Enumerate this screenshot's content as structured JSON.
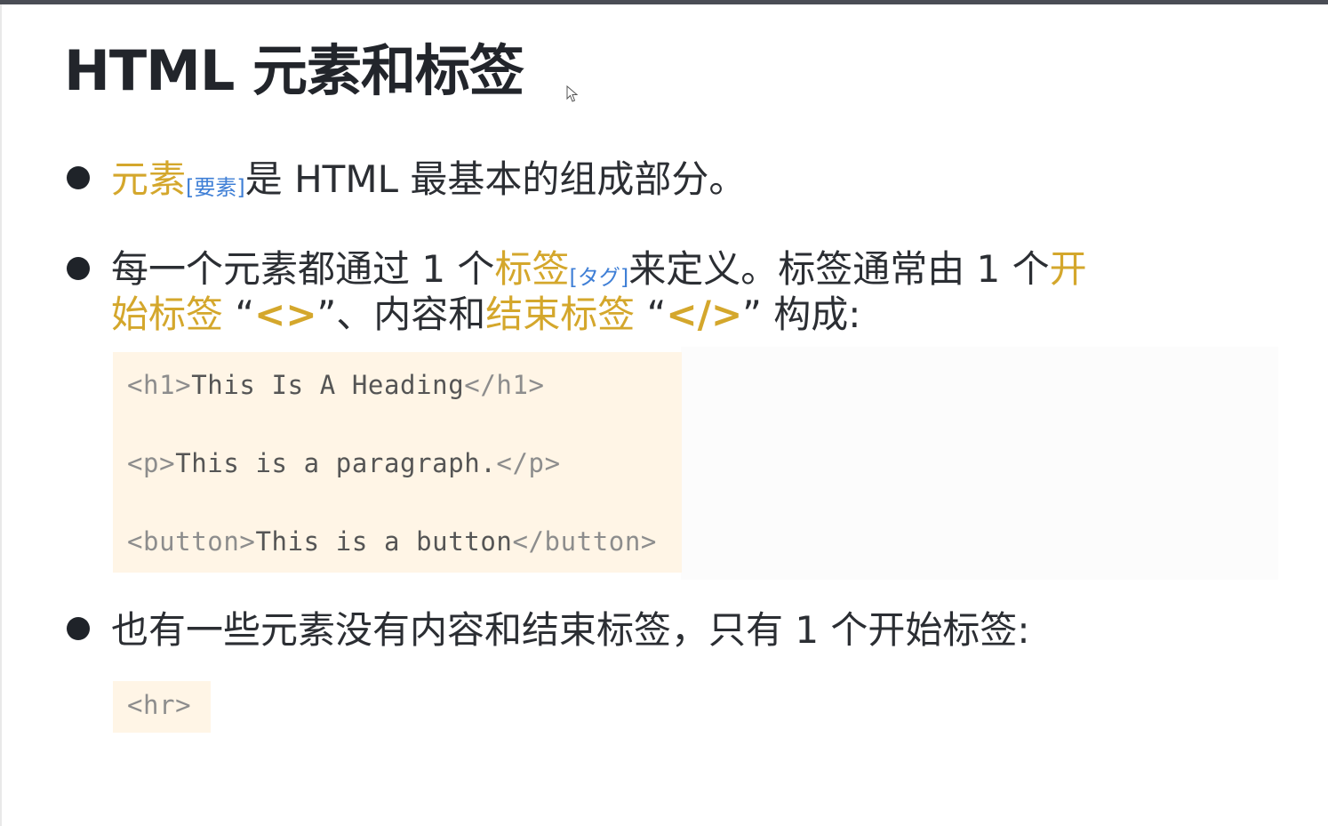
{
  "slide": {
    "title": "HTML 元素和标签"
  },
  "bullets": [
    {
      "parts": [
        {
          "text": "元素",
          "style": "hl"
        },
        {
          "text": "[要素]",
          "style": "annot"
        },
        {
          "text": "是 HTML 最基本的组成部分。",
          "style": "normal"
        }
      ]
    },
    {
      "line1": [
        {
          "text": "每一个元素都通过 1 个",
          "style": "normal"
        },
        {
          "text": "标签",
          "style": "hl"
        },
        {
          "text": "[タグ]",
          "style": "annot"
        },
        {
          "text": "来定义。标签通常由 1 个",
          "style": "normal"
        },
        {
          "text": "开",
          "style": "hl"
        }
      ],
      "line2": [
        {
          "text": "始标签",
          "style": "hl"
        },
        {
          "text": " “",
          "style": "normal"
        },
        {
          "text": "<>",
          "style": "hlb"
        },
        {
          "text": "”、内容和",
          "style": "normal"
        },
        {
          "text": "结束标签",
          "style": "hl"
        },
        {
          "text": " “",
          "style": "normal"
        },
        {
          "text": "</>",
          "style": "hlb"
        },
        {
          "text": "” 构成:",
          "style": "normal"
        }
      ]
    },
    {
      "parts": [
        {
          "text": "也有一些元素没有内容和结束标签，只有 1 个开始标签:",
          "style": "normal"
        }
      ]
    }
  ],
  "code_block_1": {
    "lines": [
      {
        "open": "<h1>",
        "content": "This Is A Heading",
        "close": "</h1>"
      },
      {
        "open": "<p>",
        "content": "This is a paragraph.",
        "close": "</p>"
      },
      {
        "open": "<button>",
        "content": "This is a button",
        "close": "</button>"
      }
    ]
  },
  "code_block_2": {
    "text": "<hr>"
  },
  "colors": {
    "highlight": "#d4a72c",
    "annotation": "#3f7fd6",
    "code_bg": "#fff5e6",
    "text": "#2b2e33"
  }
}
